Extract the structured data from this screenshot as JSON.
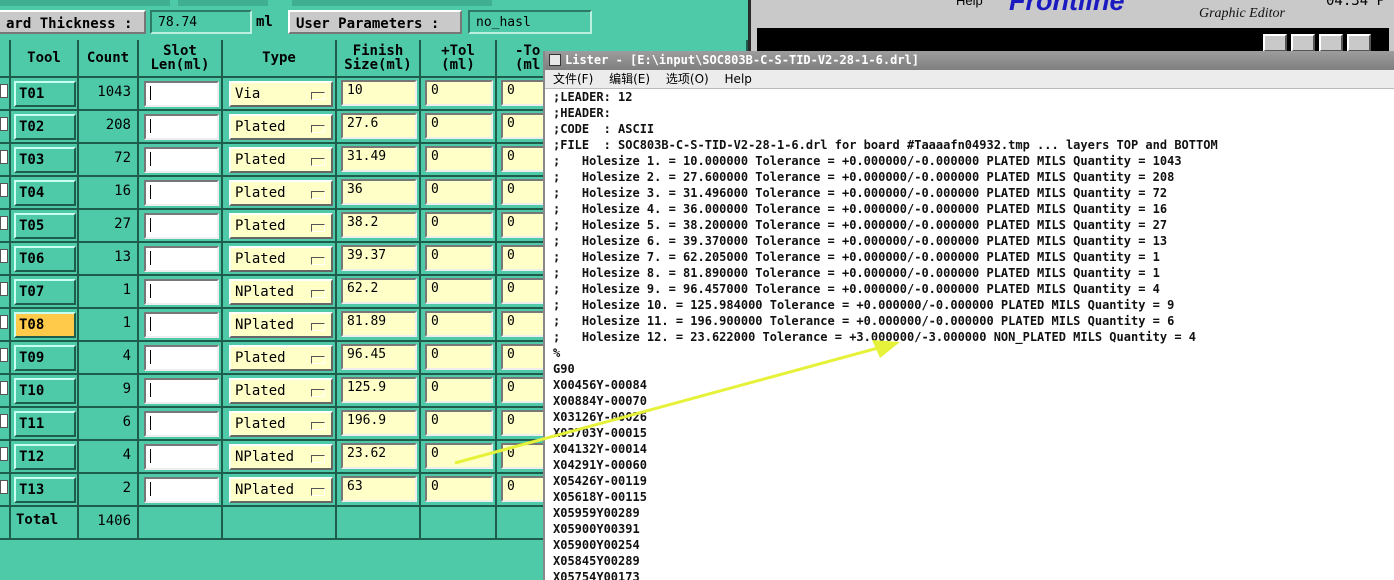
{
  "topbar": {
    "thickness_label": "ard Thickness :",
    "thickness_value": "78.74",
    "thickness_unit": "ml",
    "user_params_label": "User Parameters :",
    "user_params_value": "no_hasl"
  },
  "table": {
    "headers": {
      "tool": "Tool",
      "count": "Count",
      "slot": "Slot\nLen(ml)",
      "type": "Type",
      "finish": "Finish\nSize(ml)",
      "ptol": "+Tol\n(ml)",
      "mtol": "-To\n(ml"
    },
    "rows": [
      {
        "tool": "T01",
        "count": "1043",
        "type": "Via",
        "finish": "10",
        "ptol": "0",
        "mtol": "0",
        "selected": false
      },
      {
        "tool": "T02",
        "count": "208",
        "type": "Plated",
        "finish": "27.6",
        "ptol": "0",
        "mtol": "0",
        "selected": false
      },
      {
        "tool": "T03",
        "count": "72",
        "type": "Plated",
        "finish": "31.49",
        "ptol": "0",
        "mtol": "0",
        "selected": false
      },
      {
        "tool": "T04",
        "count": "16",
        "type": "Plated",
        "finish": "36",
        "ptol": "0",
        "mtol": "0",
        "selected": false
      },
      {
        "tool": "T05",
        "count": "27",
        "type": "Plated",
        "finish": "38.2",
        "ptol": "0",
        "mtol": "0",
        "selected": false
      },
      {
        "tool": "T06",
        "count": "13",
        "type": "Plated",
        "finish": "39.37",
        "ptol": "0",
        "mtol": "0",
        "selected": false
      },
      {
        "tool": "T07",
        "count": "1",
        "type": "NPlated",
        "finish": "62.2",
        "ptol": "0",
        "mtol": "0",
        "selected": false
      },
      {
        "tool": "T08",
        "count": "1",
        "type": "NPlated",
        "finish": "81.89",
        "ptol": "0",
        "mtol": "0",
        "selected": true
      },
      {
        "tool": "T09",
        "count": "4",
        "type": "Plated",
        "finish": "96.45",
        "ptol": "0",
        "mtol": "0",
        "selected": false
      },
      {
        "tool": "T10",
        "count": "9",
        "type": "Plated",
        "finish": "125.9",
        "ptol": "0",
        "mtol": "0",
        "selected": false
      },
      {
        "tool": "T11",
        "count": "6",
        "type": "Plated",
        "finish": "196.9",
        "ptol": "0",
        "mtol": "0",
        "selected": false
      },
      {
        "tool": "T12",
        "count": "4",
        "type": "NPlated",
        "finish": "23.62",
        "ptol": "0",
        "mtol": "0",
        "selected": false
      },
      {
        "tool": "T13",
        "count": "2",
        "type": "NPlated",
        "finish": "63",
        "ptol": "0",
        "mtol": "0",
        "selected": false
      }
    ],
    "total_label": "Total",
    "total_count": "1406"
  },
  "editor": {
    "help_label": "Help",
    "logo_text": "Frontline",
    "subtitle": "Graphic Editor",
    "time_text": "04:34 P"
  },
  "lister": {
    "title": "Lister - [E:\\input\\SOC803B-C-S-TID-V2-28-1-6.drl]",
    "menu": [
      "文件(F)",
      "编辑(E)",
      "选项(O)",
      "Help"
    ],
    "lines": [
      ";LEADER: 12",
      ";HEADER:",
      ";CODE  : ASCII",
      ";FILE  : SOC803B-C-S-TID-V2-28-1-6.drl for board #Taaaafn04932.tmp ... layers TOP and BOTTOM",
      ";   Holesize 1. = 10.000000 Tolerance = +0.000000/-0.000000 PLATED MILS Quantity = 1043",
      ";   Holesize 2. = 27.600000 Tolerance = +0.000000/-0.000000 PLATED MILS Quantity = 208",
      ";   Holesize 3. = 31.496000 Tolerance = +0.000000/-0.000000 PLATED MILS Quantity = 72",
      ";   Holesize 4. = 36.000000 Tolerance = +0.000000/-0.000000 PLATED MILS Quantity = 16",
      ";   Holesize 5. = 38.200000 Tolerance = +0.000000/-0.000000 PLATED MILS Quantity = 27",
      ";   Holesize 6. = 39.370000 Tolerance = +0.000000/-0.000000 PLATED MILS Quantity = 13",
      ";   Holesize 7. = 62.205000 Tolerance = +0.000000/-0.000000 PLATED MILS Quantity = 1",
      ";   Holesize 8. = 81.890000 Tolerance = +0.000000/-0.000000 PLATED MILS Quantity = 1",
      ";   Holesize 9. = 96.457000 Tolerance = +0.000000/-0.000000 PLATED MILS Quantity = 4",
      ";   Holesize 10. = 125.984000 Tolerance = +0.000000/-0.000000 PLATED MILS Quantity = 9",
      ";   Holesize 11. = 196.900000 Tolerance = +0.000000/-0.000000 PLATED MILS Quantity = 6",
      ";   Holesize 12. = 23.622000 Tolerance = +3.000000/-3.000000 NON_PLATED MILS Quantity = 4",
      "%",
      "G90",
      "X00456Y-00084",
      "X00884Y-00070",
      "X03126Y-00026",
      "X03703Y-00015",
      "X04132Y-00014",
      "X04291Y-00060",
      "X05426Y-00119",
      "X05618Y-00115",
      "X05959Y00289",
      "X05900Y00391",
      "X05900Y00254",
      "X05845Y00289",
      "X05754Y00173"
    ]
  },
  "colors": {
    "app_bg": "#4fcaa9",
    "input_bg": "#ffffc8",
    "selected_tool": "#ffc94a",
    "arrow": "#e6f23a"
  }
}
